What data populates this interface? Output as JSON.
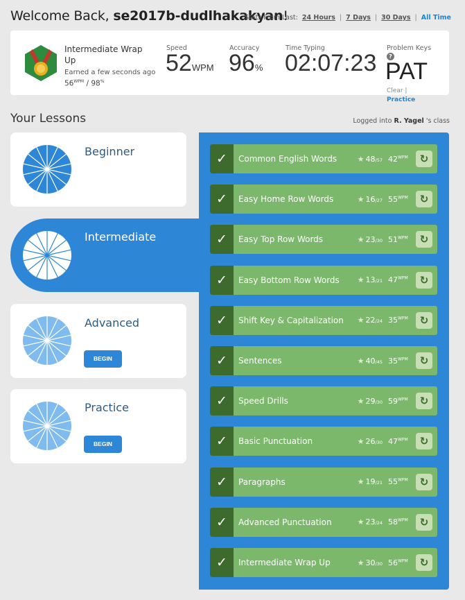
{
  "header": {
    "welcome_prefix": "Welcome Back, ",
    "username": "se2017b-dudlhakakyan",
    "exclaim": "!",
    "stats_from": "Stats From Last:",
    "ranges": [
      "24 Hours",
      "7 Days",
      "30 Days",
      "All Time"
    ],
    "active_range": "All Time"
  },
  "stats": {
    "achievement_title": "Intermediate Wrap Up",
    "achievement_earned": "Earned a few seconds ago",
    "achievement_wpm": "56",
    "achievement_wpm_unit": "WPM",
    "achievement_sep": " / ",
    "achievement_acc": "98",
    "achievement_acc_unit": "%",
    "speed_label": "Speed",
    "speed_value": "52",
    "speed_unit": "WPM",
    "accuracy_label": "Accuracy",
    "accuracy_value": "96",
    "accuracy_unit": "%",
    "time_label": "Time Typing",
    "time_value": "02:07:23",
    "problem_label": "Problem Keys",
    "problem_help": "?",
    "problem_value": "PAT",
    "clear_label": "Clear |",
    "practice_label": "Practice",
    "colors": {
      "badge_green": "#2e8b3e",
      "medal_gold": "#e8b020",
      "ribbon_red": "#c0392b"
    }
  },
  "lessons_header": {
    "title": "Your Lessons",
    "logged_prefix": "Logged into ",
    "teacher": "R. Yagel",
    "logged_suffix": "'s class"
  },
  "levels": [
    {
      "name": "Beginner",
      "pie_color": "#2d87d6",
      "button": ""
    },
    {
      "name": "Intermediate",
      "pie_color": "#ffffff",
      "button": ""
    },
    {
      "name": "Advanced",
      "pie_color": "#7fbbef",
      "button": "BEGIN"
    },
    {
      "name": "Practice",
      "pie_color": "#7fbbef",
      "button": "BEGIN"
    }
  ],
  "lessons": [
    {
      "name": "Common English Words",
      "stars": "48",
      "stars_total": "/57",
      "wpm": "42",
      "wpm_unit": "WPM"
    },
    {
      "name": "Easy Home Row Words",
      "stars": "16",
      "stars_total": "/27",
      "wpm": "55",
      "wpm_unit": "WPM"
    },
    {
      "name": "Easy Top Row Words",
      "stars": "23",
      "stars_total": "/30",
      "wpm": "51",
      "wpm_unit": "WPM"
    },
    {
      "name": "Easy Bottom Row Words",
      "stars": "13",
      "stars_total": "/21",
      "wpm": "47",
      "wpm_unit": "WPM"
    },
    {
      "name": "Shift Key & Capitalization",
      "stars": "22",
      "stars_total": "/24",
      "wpm": "35",
      "wpm_unit": "WPM"
    },
    {
      "name": "Sentences",
      "stars": "40",
      "stars_total": "/45",
      "wpm": "35",
      "wpm_unit": "WPM"
    },
    {
      "name": "Speed Drills",
      "stars": "29",
      "stars_total": "/30",
      "wpm": "59",
      "wpm_unit": "WPM"
    },
    {
      "name": "Basic Punctuation",
      "stars": "26",
      "stars_total": "/30",
      "wpm": "47",
      "wpm_unit": "WPM"
    },
    {
      "name": "Paragraphs",
      "stars": "19",
      "stars_total": "/21",
      "wpm": "55",
      "wpm_unit": "WPM"
    },
    {
      "name": "Advanced Punctuation",
      "stars": "23",
      "stars_total": "/24",
      "wpm": "58",
      "wpm_unit": "WPM"
    },
    {
      "name": "Intermediate Wrap Up",
      "stars": "30",
      "stars_total": "/30",
      "wpm": "56",
      "wpm_unit": "WPM"
    }
  ],
  "icons": {
    "check": "✓",
    "star": "★",
    "redo": "↻"
  }
}
